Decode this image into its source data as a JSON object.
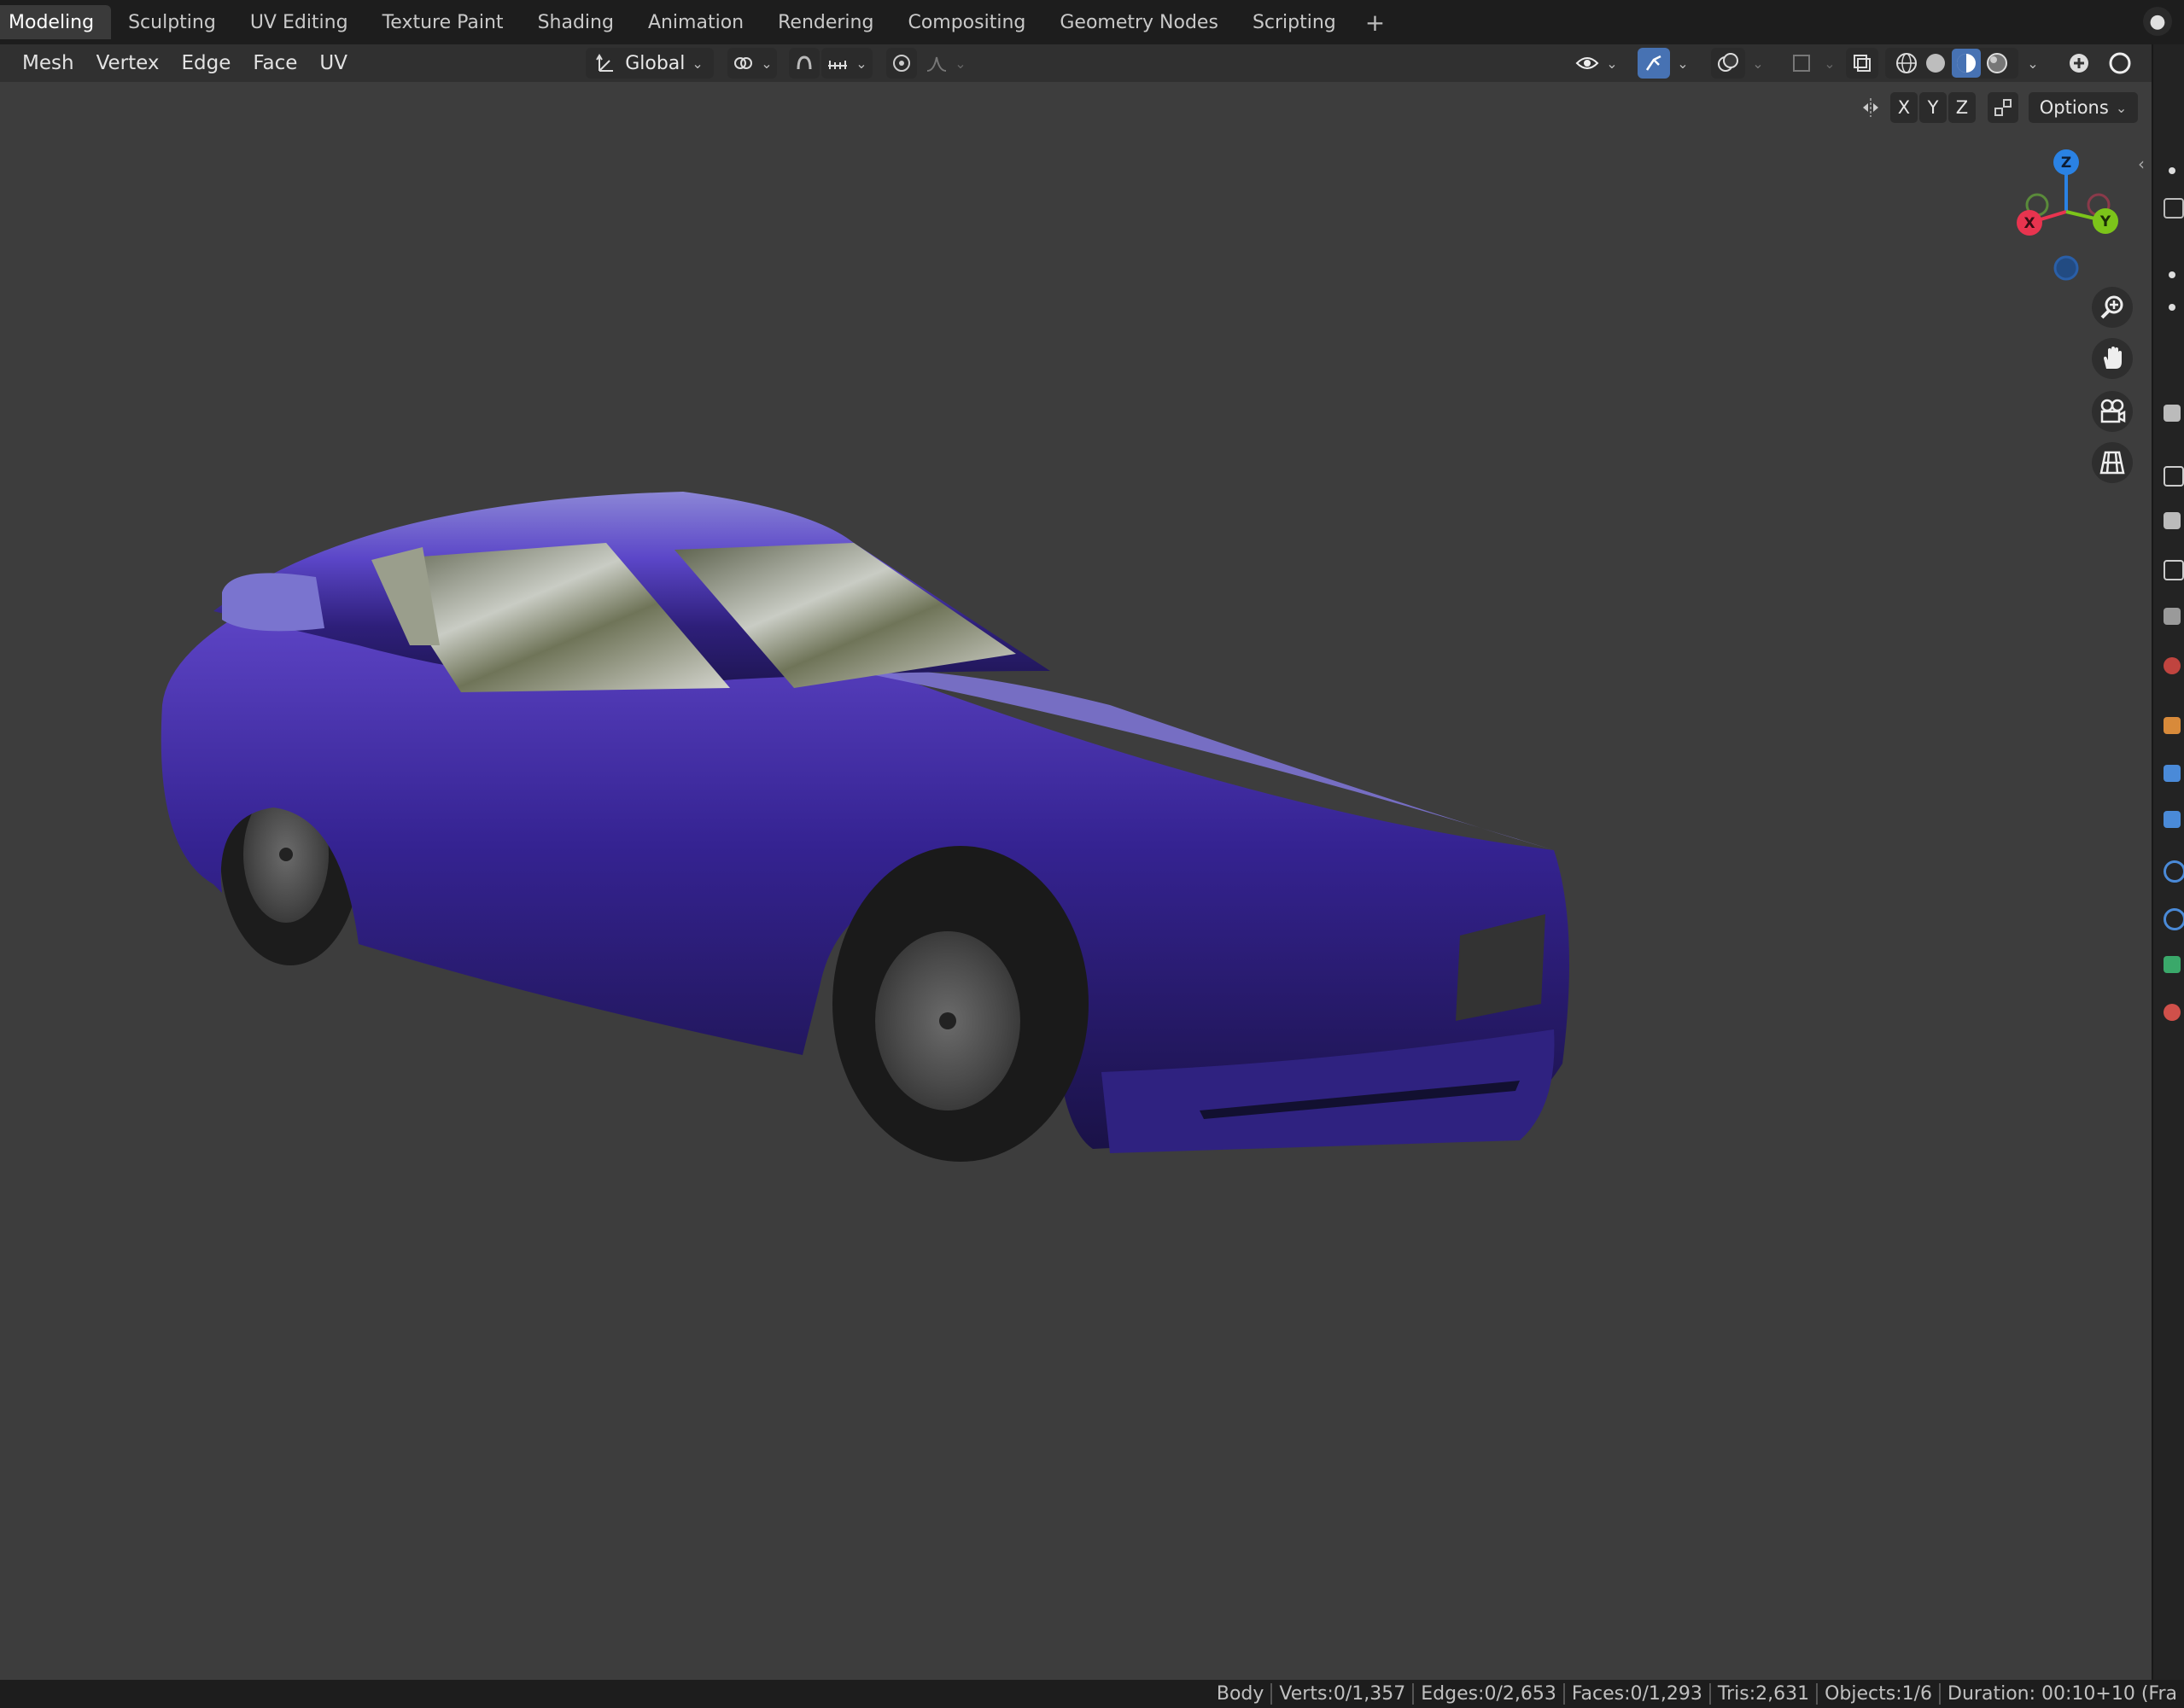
{
  "tabs": [
    "Modeling",
    "Sculpting",
    "UV Editing",
    "Texture Paint",
    "Shading",
    "Animation",
    "Rendering",
    "Compositing",
    "Geometry Nodes",
    "Scripting"
  ],
  "add_tab": "+",
  "menu": [
    "Mesh",
    "Vertex",
    "Edge",
    "Face",
    "UV"
  ],
  "transform_orientation": "Global",
  "viewport_options": {
    "x": "X",
    "y": "Y",
    "z": "Z",
    "options": "Options"
  },
  "gizmo": {
    "x": "X",
    "y": "Y",
    "z": "Z"
  },
  "status": [
    "Body",
    "Verts:0/1,357",
    "Edges:0/2,653",
    "Faces:0/1,293",
    "Tris:2,631",
    "Objects:1/6",
    "Duration: 00:10+10 (Fra"
  ],
  "colors": {
    "accent": "#4772b3",
    "car_body": "#4a3bb8",
    "gizmo_x": "#e8344f",
    "gizmo_y": "#7cc41a",
    "gizmo_z": "#2a82e4"
  },
  "icons": [
    "transform-icon",
    "snap-icon",
    "proportional-icon",
    "visibility-icon",
    "gizmo-icon",
    "overlay-icon",
    "xray-icon",
    "wireframe-shading-icon",
    "solid-shading-icon",
    "material-shading-icon",
    "rendered-shading-icon",
    "zoom-icon",
    "pan-hand-icon",
    "camera-icon",
    "grid-icon"
  ]
}
